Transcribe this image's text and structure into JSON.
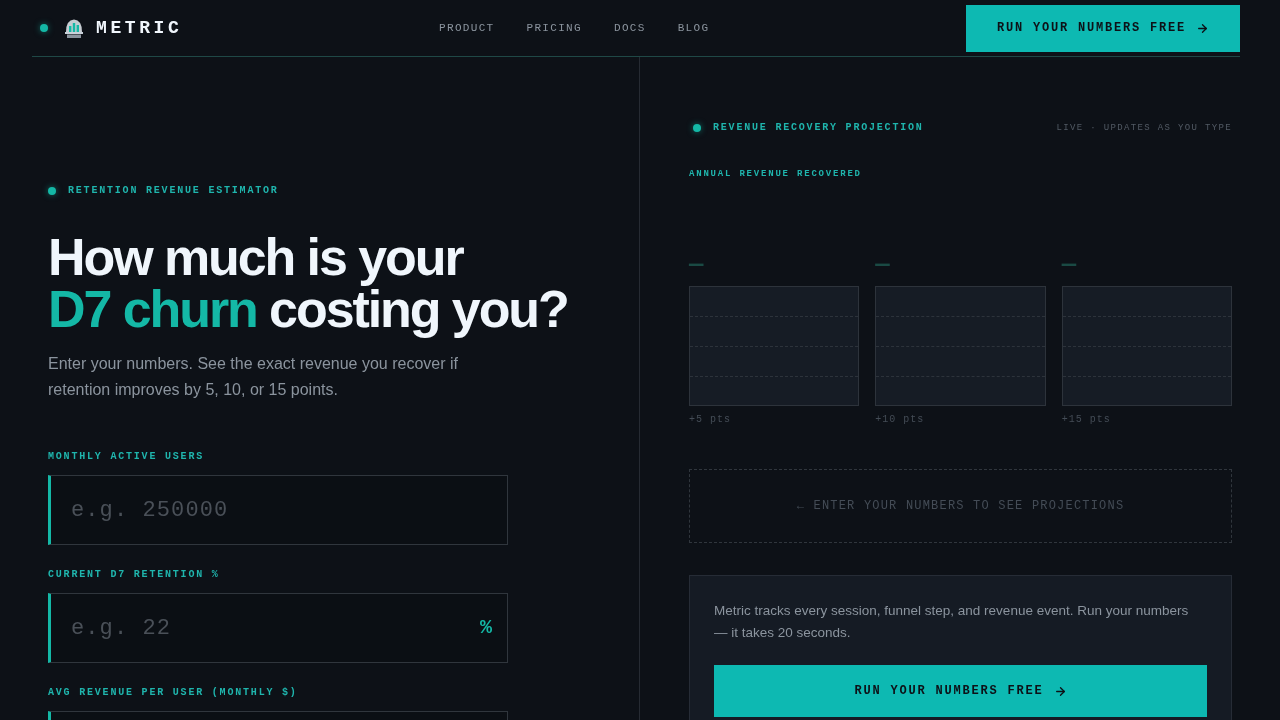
{
  "header": {
    "brand": "METRIC",
    "nav": [
      {
        "label": "PRODUCT"
      },
      {
        "label": "PRICING"
      },
      {
        "label": "DOCS"
      },
      {
        "label": "BLOG"
      }
    ],
    "cta": "RUN YOUR NUMBERS FREE"
  },
  "estimator": {
    "eyebrow": "RETENTION REVENUE ESTIMATOR",
    "title_lines": [
      [
        {
          "text": "How much is your",
          "accent": false
        }
      ],
      [
        {
          "text": "D7 churn",
          "accent": true
        },
        {
          "text": "costing you?",
          "accent": false
        }
      ]
    ],
    "subtitle": "Enter your numbers. See the exact revenue you recover if retention improves by 5, 10, or 15 points.",
    "fields": [
      {
        "label": "MONTHLY ACTIVE USERS",
        "placeholder": "e.g. 250000"
      },
      {
        "label": "CURRENT D7 RETENTION %",
        "placeholder": "e.g. 22",
        "suffix": "%"
      },
      {
        "label": "AVG REVENUE PER USER (MONTHLY $)"
      }
    ]
  },
  "projection": {
    "title": "REVENUE RECOVERY PROJECTION",
    "status": "LIVE · UPDATES AS YOU TYPE",
    "metric_label": "ANNUAL REVENUE RECOVERED",
    "scenarios": [
      {
        "value": "—",
        "label": "+5 pts"
      },
      {
        "value": "—",
        "label": "+10 pts"
      },
      {
        "value": "—",
        "label": "+15 pts"
      }
    ],
    "empty_message": "← ENTER YOUR NUMBERS TO SEE PROJECTIONS"
  },
  "cta_card": {
    "text": "Metric tracks every session, funnel step, and revenue event. Run your numbers — it takes 20 seconds.",
    "button": "RUN YOUR NUMBERS FREE"
  }
}
